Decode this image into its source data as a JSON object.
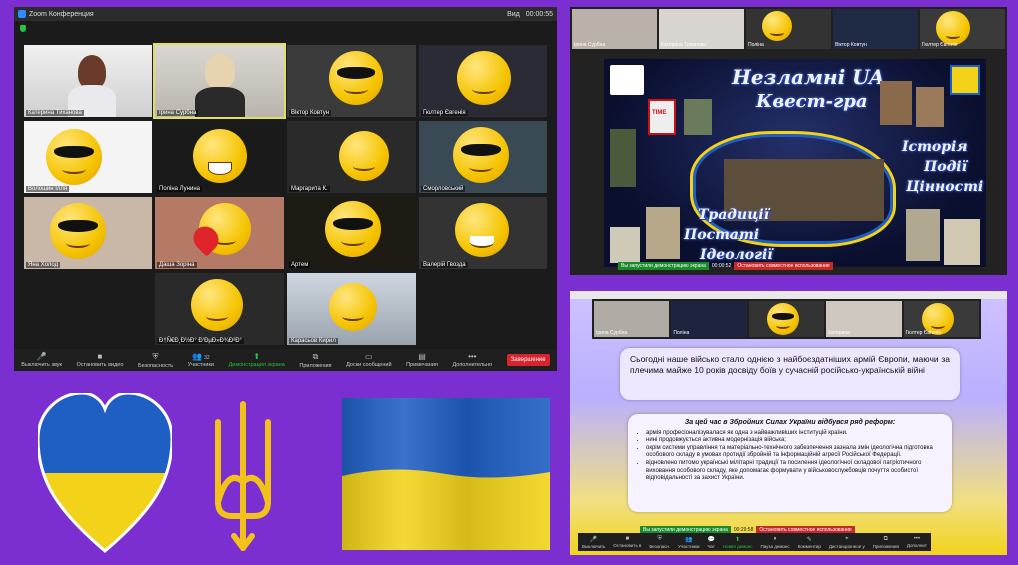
{
  "zoom_main": {
    "window_title": "Zoom Конференция",
    "view_label": "Вид",
    "timer": "00:00:55",
    "tiles": [
      {
        "name": "Катерина Тиханова"
      },
      {
        "name": "Ірина Сурбна"
      },
      {
        "name": "Віктор Ковтун"
      },
      {
        "name": "Гюлтер Євгенія"
      },
      {
        "name": "Волошин Ілля"
      },
      {
        "name": "Поліна Лунина"
      },
      {
        "name": "Маргарита К."
      },
      {
        "name": "Сморловський"
      },
      {
        "name": "Яна Холод"
      },
      {
        "name": "Даша Зоріна"
      },
      {
        "name": "Артем"
      },
      {
        "name": "Валерій Гвозда"
      },
      {
        "name": "Ð†Ñ€Ð¸Ð½Ð° Ð‘ÐµÐ»Ð¾Ð²Ð°"
      },
      {
        "name": "Карасьов Кирил"
      }
    ],
    "toolbar": {
      "mute": "Выключить звук",
      "video": "Остановить видео",
      "security": "Безопасность",
      "participants": "Участники",
      "participants_count": "32",
      "share": "Демонстрация экрана",
      "apps": "Приложения",
      "whiteboards": "Доски сообщений",
      "notes": "Примечания",
      "more": "Дополнительно",
      "end": "Завершение"
    }
  },
  "zoom_quest": {
    "thumbs": [
      {
        "name": "Ірина Сурбна"
      },
      {
        "name": "Катерина Тиханова"
      },
      {
        "name": "Поліна"
      },
      {
        "name": "Віктор Ковтун"
      },
      {
        "name": "Гюлтер Євгенія"
      }
    ],
    "title_line1": "Незламні UA",
    "title_line2": "Квест-гра",
    "words_right": [
      "Історія",
      "Події",
      "Цінності"
    ],
    "words_left": [
      "Традиції",
      "Постаті",
      "Ідеології"
    ],
    "time_magazine": "TIME",
    "share_notice": "Вы запустили демонстрацию экрана",
    "share_timer": "00:00:52",
    "stop_share": "Остановить совместное использование"
  },
  "zoom_slide": {
    "thumbs": [
      {
        "name": "Ірина Сурбна"
      },
      {
        "name": "Поліна"
      },
      {
        "name": "Катерина"
      },
      {
        "name": "Гюлтер Євгенія"
      }
    ],
    "paragraph": "Сьогодні наше військо стало однією з найбоєздатніших армій Європи, маючи за плечима майже 10 років досвіду боїв у сучасній російсько-українській війні",
    "reforms_heading": "За цей час в Збройних Силах України відбувся ряд реформ:",
    "reforms": [
      "армія професіоналізувалася як одна з найважливіших інституцій країни.",
      "нині продовжується активна модернізація війська;",
      "окрім системи управління та матеріально-технічного забезпечення зазнала змін ідеологічна підготовка особового складу в умовах протидії збройній та інформаційній агресії Російської Федерації.",
      "відновлено питомо українські мілітарні традиції та посилення ідеологічної складової патріотичного виховання особового складу, яке допомагає формувати у військовослужбовців почуття особистої відповідальності за захист України."
    ],
    "share_notice": "Вы запустили демонстрацию экрана",
    "share_timer": "00:29:58",
    "stop_share": "Остановить совместное использование",
    "toolbar": [
      "Выключить",
      "Остановить в",
      "Безопасн.",
      "Участники",
      "Чат",
      "Новая демонс",
      "Пауза демонс",
      "Комментир",
      "Дистанционное у",
      "Приложения",
      "Дополнит"
    ]
  },
  "colors": {
    "background": "#7b2fd0",
    "flag_blue": "#1f5fc4",
    "flag_yellow": "#f3d31a",
    "trident_gold": "#f2c21b"
  }
}
